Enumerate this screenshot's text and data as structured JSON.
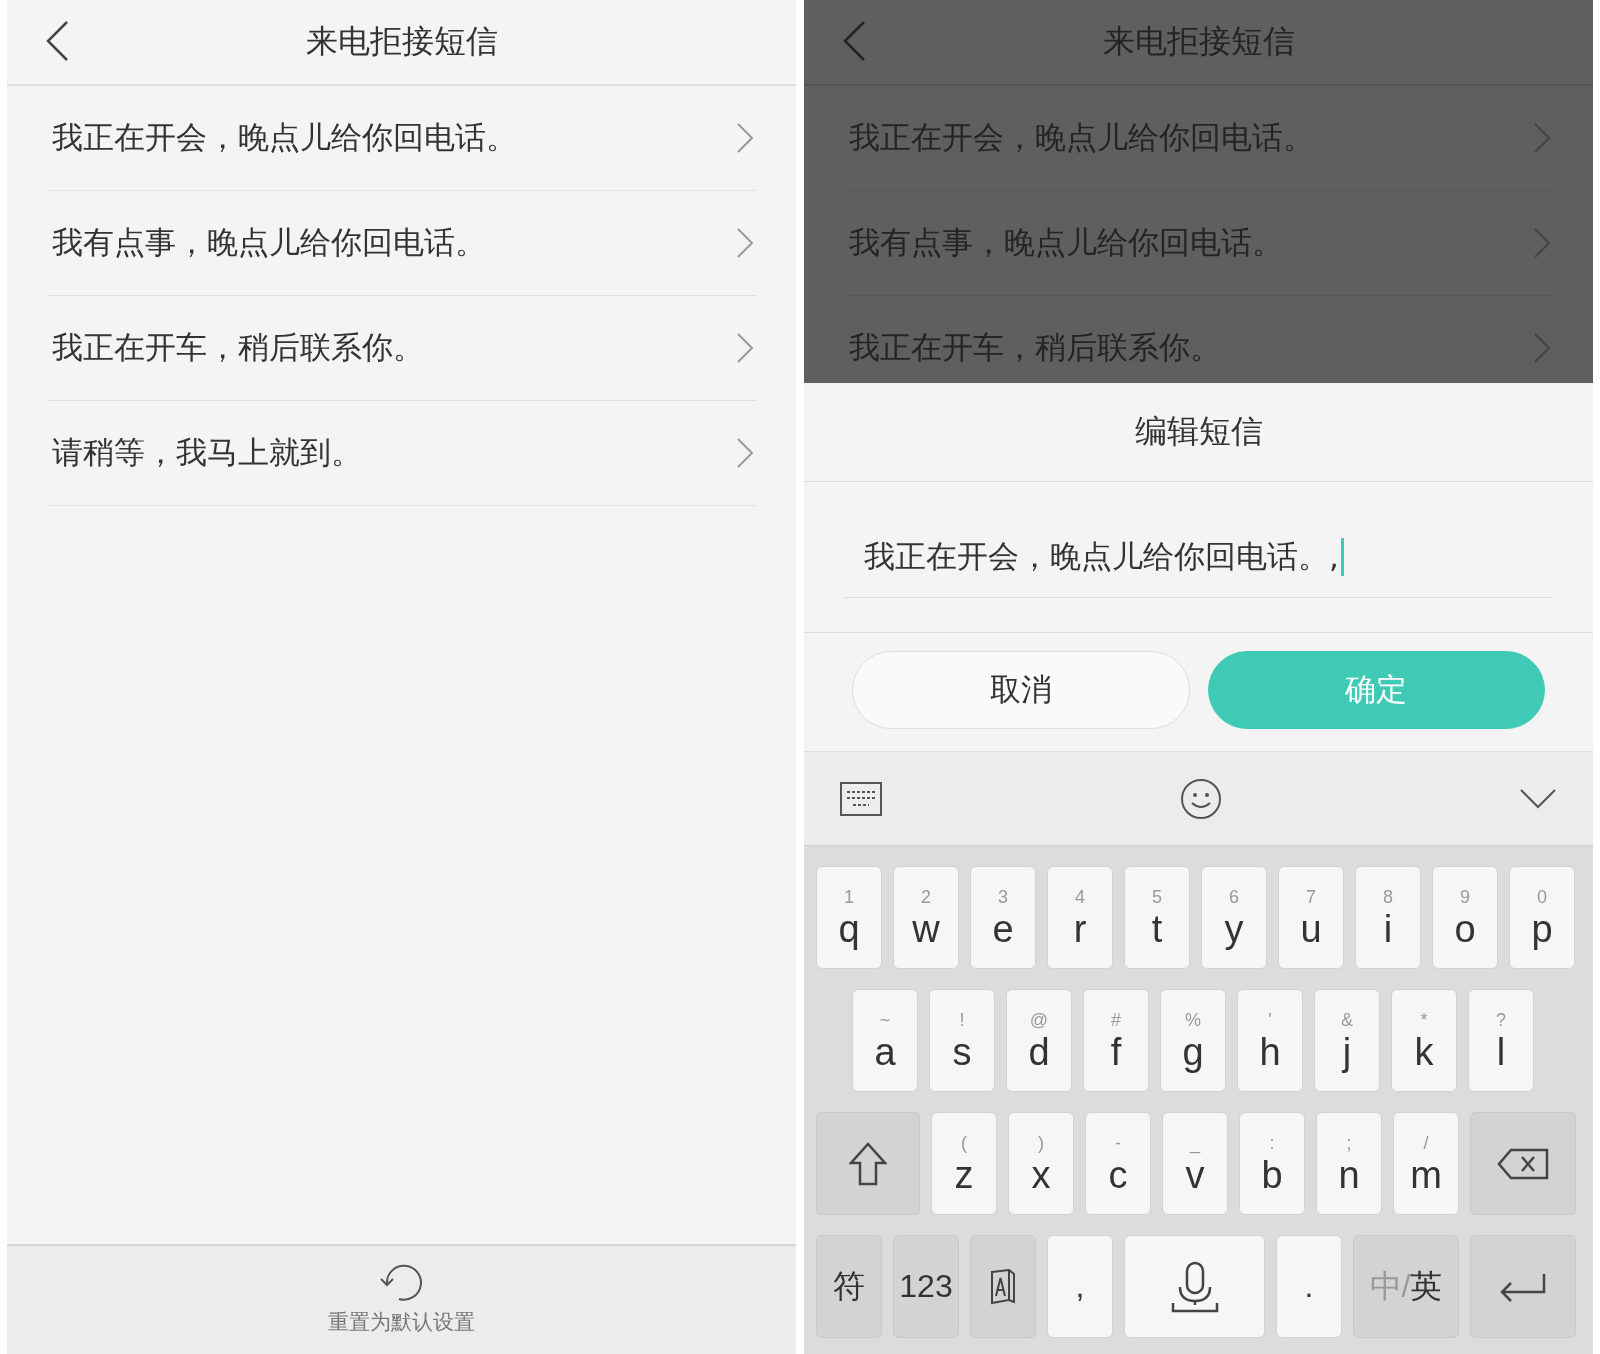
{
  "left_screen": {
    "header": {
      "title": "来电拒接短信"
    },
    "messages": [
      {
        "text": "我正在开会，晚点儿给你回电话。"
      },
      {
        "text": "我有点事，晚点儿给你回电话。"
      },
      {
        "text": "我正在开车，稍后联系你。"
      },
      {
        "text": "请稍等，我马上就到。"
      }
    ],
    "reset_button": {
      "label": "重置为默认设置"
    }
  },
  "right_screen": {
    "dimmed": true,
    "header": {
      "title": "来电拒接短信"
    },
    "messages": [
      {
        "text": "我正在开会，晚点儿给你回电话。"
      },
      {
        "text": "我有点事，晚点儿给你回电话。"
      },
      {
        "text": "我正在开车，稍后联系你。"
      }
    ],
    "dialog": {
      "title": "编辑短信",
      "input": {
        "value": "我正在开会，晚点儿给你回电话。,"
      },
      "buttons": [
        {
          "label": "取消",
          "kind": "secondary"
        },
        {
          "label": "确定",
          "kind": "primary"
        }
      ]
    },
    "keyboard": {
      "rows": [
        {
          "keys": [
            {
              "kind": "letter",
              "hint": "1",
              "label": "q"
            },
            {
              "kind": "letter",
              "hint": "2",
              "label": "w"
            },
            {
              "kind": "letter",
              "hint": "3",
              "label": "e"
            },
            {
              "kind": "letter",
              "hint": "4",
              "label": "r"
            },
            {
              "kind": "letter",
              "hint": "5",
              "label": "t"
            },
            {
              "kind": "letter",
              "hint": "6",
              "label": "y"
            },
            {
              "kind": "letter",
              "hint": "7",
              "label": "u"
            },
            {
              "kind": "letter",
              "hint": "8",
              "label": "i"
            },
            {
              "kind": "letter",
              "hint": "9",
              "label": "o"
            },
            {
              "kind": "letter",
              "hint": "0",
              "label": "p"
            }
          ]
        },
        {
          "keys": [
            {
              "kind": "letter",
              "hint": "~",
              "label": "a"
            },
            {
              "kind": "letter",
              "hint": "!",
              "label": "s"
            },
            {
              "kind": "letter",
              "hint": "@",
              "label": "d"
            },
            {
              "kind": "letter",
              "hint": "#",
              "label": "f"
            },
            {
              "kind": "letter",
              "hint": "%",
              "label": "g"
            },
            {
              "kind": "letter",
              "hint": "'",
              "label": "h"
            },
            {
              "kind": "letter",
              "hint": "&",
              "label": "j"
            },
            {
              "kind": "letter",
              "hint": "*",
              "label": "k"
            },
            {
              "kind": "letter",
              "hint": "?",
              "label": "l"
            }
          ]
        },
        {
          "keys": [
            {
              "kind": "shift"
            },
            {
              "kind": "letter",
              "hint": "(",
              "label": "z"
            },
            {
              "kind": "letter",
              "hint": ")",
              "label": "x"
            },
            {
              "kind": "letter",
              "hint": "-",
              "label": "c"
            },
            {
              "kind": "letter",
              "hint": "_",
              "label": "v"
            },
            {
              "kind": "letter",
              "hint": ":",
              "label": "b"
            },
            {
              "kind": "letter",
              "hint": ";",
              "label": "n"
            },
            {
              "kind": "letter",
              "hint": "/",
              "label": "m"
            },
            {
              "kind": "backspace"
            }
          ]
        },
        {
          "keys": [
            {
              "kind": "function",
              "label": "符"
            },
            {
              "kind": "function",
              "label": "123"
            },
            {
              "kind": "ai"
            },
            {
              "kind": "punct",
              "label": ","
            },
            {
              "kind": "mic"
            },
            {
              "kind": "punct",
              "label": "."
            },
            {
              "kind": "lang",
              "dim": "中/",
              "label": "英"
            },
            {
              "kind": "enter"
            }
          ]
        }
      ]
    }
  }
}
